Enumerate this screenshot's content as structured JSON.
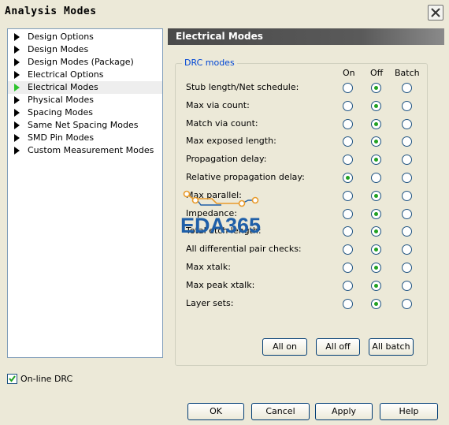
{
  "window": {
    "title": "Analysis Modes"
  },
  "nav": {
    "items": [
      {
        "label": "Design Options",
        "selected": false
      },
      {
        "label": "Design Modes",
        "selected": false
      },
      {
        "label": "Design Modes (Package)",
        "selected": false
      },
      {
        "label": "Electrical Options",
        "selected": false
      },
      {
        "label": "Electrical Modes",
        "selected": true
      },
      {
        "label": "Physical Modes",
        "selected": false
      },
      {
        "label": "Spacing Modes",
        "selected": false
      },
      {
        "label": "Same Net Spacing Modes",
        "selected": false
      },
      {
        "label": "SMD Pin Modes",
        "selected": false
      },
      {
        "label": "Custom Measurement Modes",
        "selected": false
      }
    ]
  },
  "panel": {
    "title": "Electrical Modes"
  },
  "drc": {
    "legend": "DRC modes",
    "columns": [
      "On",
      "Off",
      "Batch"
    ],
    "rows": [
      {
        "label": "Stub length/Net schedule:",
        "selected": "Off"
      },
      {
        "label": "Max via count:",
        "selected": "Off"
      },
      {
        "label": "Match via count:",
        "selected": "Off"
      },
      {
        "label": "Max exposed length:",
        "selected": "Off"
      },
      {
        "label": "Propagation delay:",
        "selected": "Off"
      },
      {
        "label": "Relative propagation delay:",
        "selected": "On"
      },
      {
        "label": "Max parallel:",
        "selected": "Off"
      },
      {
        "label": "Impedance:",
        "selected": "Off"
      },
      {
        "label": "Total etch length:",
        "selected": "Off"
      },
      {
        "label": "All differential pair checks:",
        "selected": "Off"
      },
      {
        "label": "Max xtalk:",
        "selected": "Off"
      },
      {
        "label": "Max peak xtalk:",
        "selected": "Off"
      },
      {
        "label": "Layer sets:",
        "selected": "Off"
      }
    ],
    "buttons": {
      "all_on": "All on",
      "all_off": "All off",
      "all_batch": "All batch"
    }
  },
  "online_drc": {
    "label": "On-line DRC",
    "checked": true
  },
  "footer": {
    "ok": "OK",
    "cancel": "Cancel",
    "apply": "Apply",
    "help": "Help"
  },
  "watermark": {
    "text": "EDA365",
    "color": "#1f5fa8"
  },
  "colors": {
    "header_bg": "#4a4a4a",
    "radio_dot": "#21a121",
    "legend_text": "#0046d5",
    "selected_arrow": "#2ec42e"
  }
}
